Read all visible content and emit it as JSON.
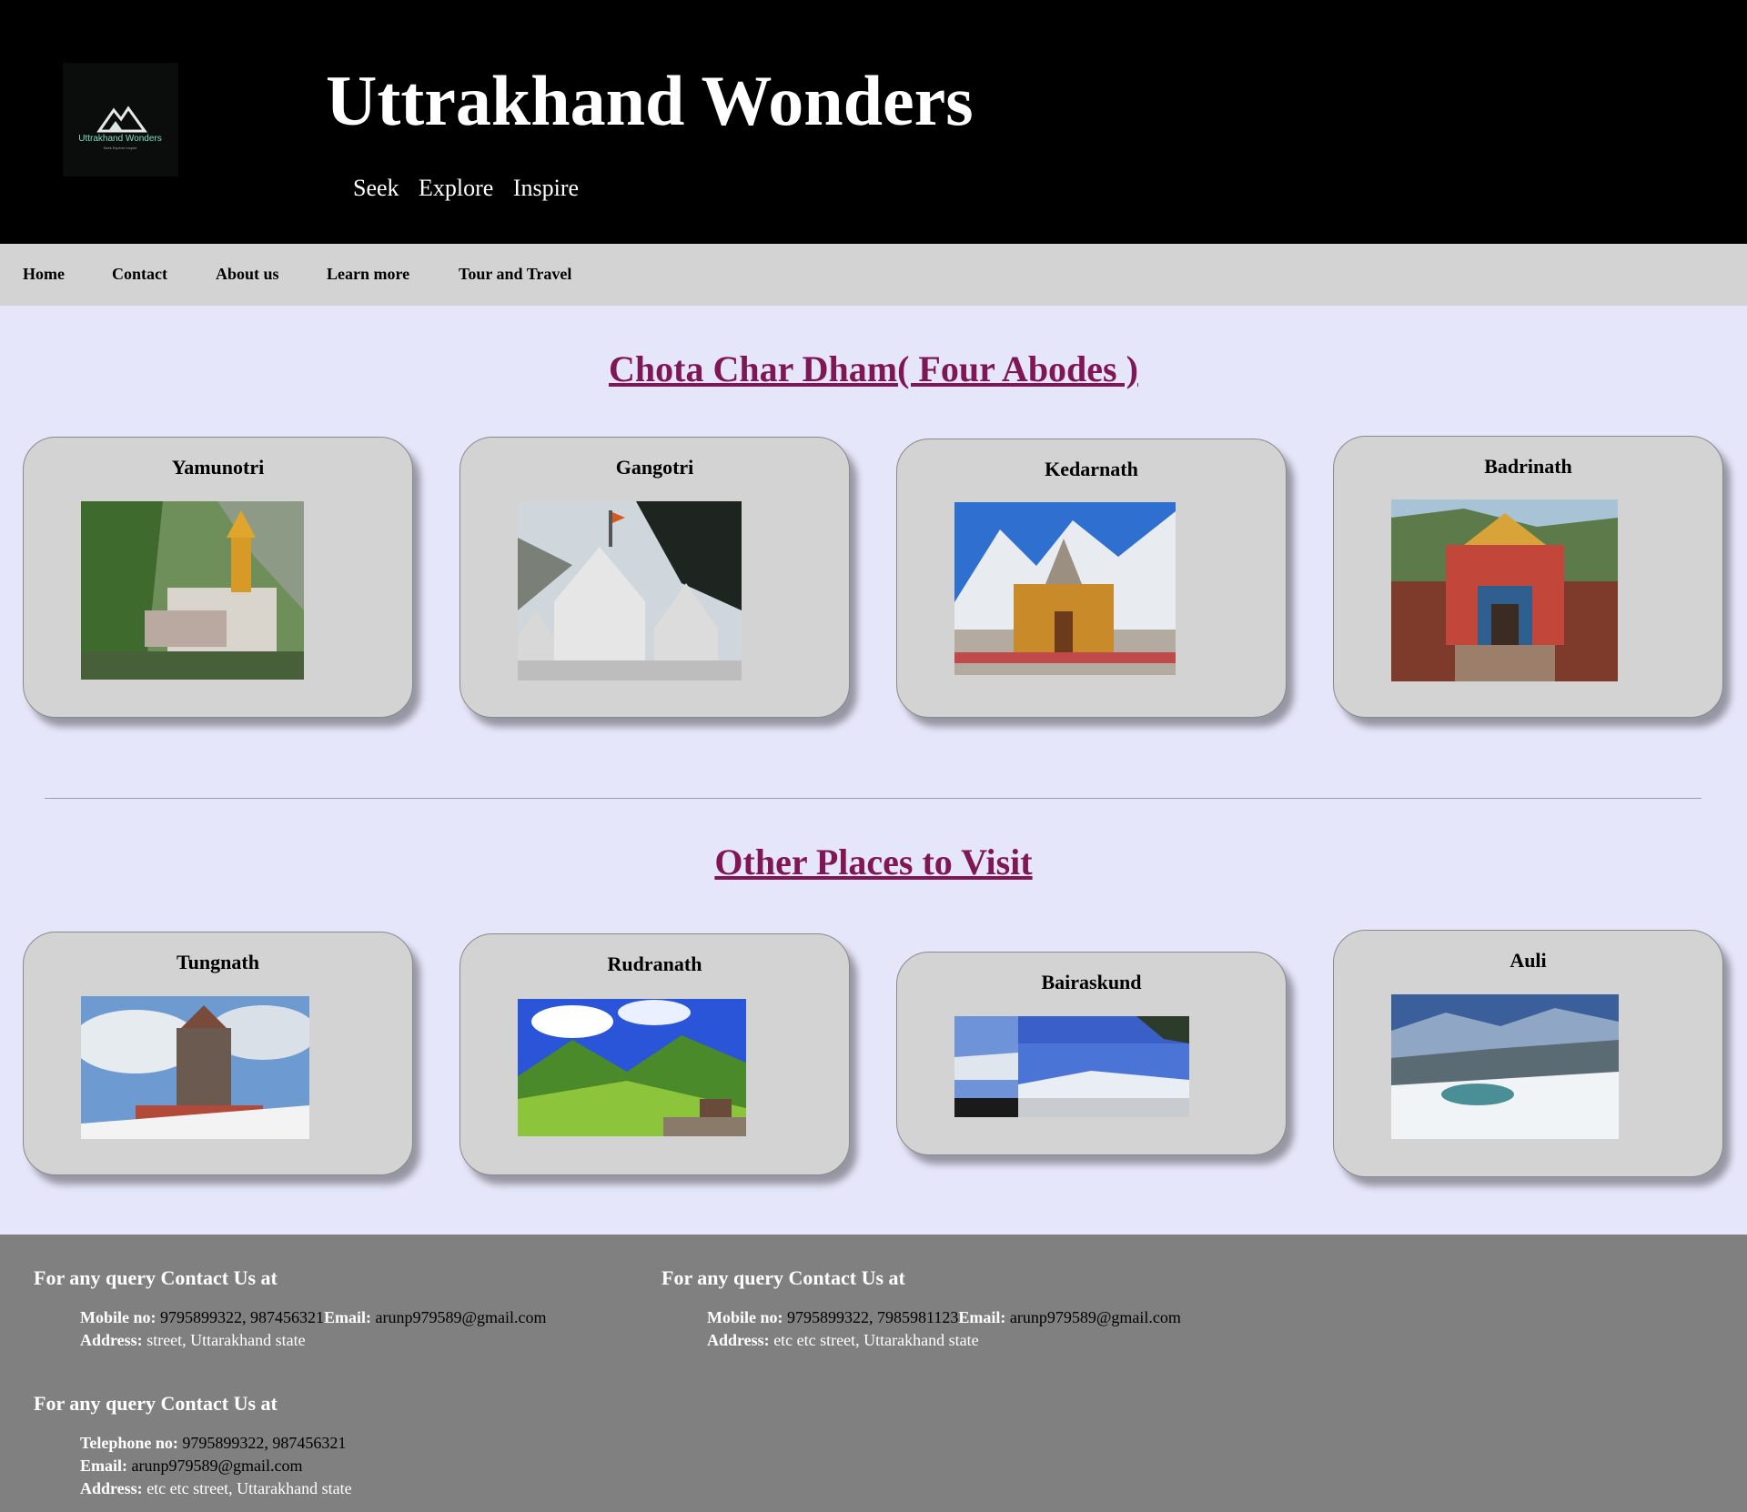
{
  "header": {
    "logo_text": "Uttrakhand Wonders",
    "logo_subtext": "Seek Explore Inspire",
    "title": "Uttrakhand Wonders",
    "tagline": [
      "Seek",
      "Explore",
      "Inspire"
    ]
  },
  "nav": [
    "Home",
    "Contact",
    "About us",
    "Learn more",
    "Tour and Travel"
  ],
  "sections": [
    {
      "title": "Chota Char Dham( Four Abodes )",
      "cards": [
        {
          "name": "Yamunotri",
          "image": "yamunotri-temple-photo"
        },
        {
          "name": "Gangotri",
          "image": "gangotri-temple-photo"
        },
        {
          "name": "Kedarnath",
          "image": "kedarnath-temple-photo"
        },
        {
          "name": "Badrinath",
          "image": "badrinath-temple-photo"
        }
      ]
    },
    {
      "title": "Other Places to Visit",
      "cards": [
        {
          "name": "Tungnath",
          "image": "tungnath-temple-photo"
        },
        {
          "name": "Rudranath",
          "image": "rudranath-meadow-photo"
        },
        {
          "name": "Bairaskund",
          "image": "bairaskund-landscape-photo"
        },
        {
          "name": "Auli",
          "image": "auli-snow-photo"
        }
      ]
    }
  ],
  "footer": {
    "blocks": [
      {
        "title": "For any query Contact Us at",
        "mobile_label": "Mobile no:",
        "mobile": "9795899322, 987456321",
        "email_label": "Email:",
        "email": "arunp979589@gmail.com",
        "address_label": "Address:",
        "address": "street, Uttarakhand state"
      },
      {
        "title": "For any query Contact Us at",
        "mobile_label": "Mobile no:",
        "mobile": "9795899322, 7985981123",
        "email_label": "Email:",
        "email": "arunp979589@gmail.com",
        "address_label": "Address:",
        "address": "etc etc street, Uttarakhand state"
      },
      {
        "title": "For any query Contact Us at",
        "telephone_label": "Telephone no:",
        "telephone": "9795899322, 987456321",
        "email_label": "Email:",
        "email": "arunp979589@gmail.com",
        "address_label": "Address:",
        "address": "etc etc street, Uttarakhand state"
      }
    ]
  },
  "colors": {
    "page_bg": "#e6e6fa",
    "header_bg": "#000000",
    "nav_bg": "#d3d3d3",
    "heading": "#7f1655",
    "card_bg": "#d3d3d3",
    "footer_bg": "#808080"
  }
}
